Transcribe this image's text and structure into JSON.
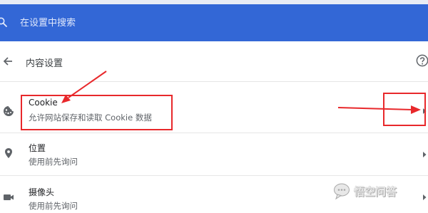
{
  "search": {
    "placeholder": "在设置中搜索",
    "icon": "search-icon"
  },
  "subpage": {
    "title": "内容设置",
    "back_icon": "arrow-back-icon",
    "help_icon": "help-circle-icon"
  },
  "rows": [
    {
      "title": "Cookie",
      "subtitle": "允许网站保存和读取 Cookie 数据",
      "icon": "cookie-icon"
    },
    {
      "title": "位置",
      "subtitle": "使用前先询问",
      "icon": "location-pin-icon"
    },
    {
      "title": "摄像头",
      "subtitle": "使用前先询问",
      "icon": "videocam-icon"
    }
  ],
  "watermark": {
    "text": "悟空问答"
  },
  "colors": {
    "header_blue": "#3367d6",
    "annotation_red": "#e8282b",
    "icon_gray": "#5f6368",
    "text_primary": "#202124"
  }
}
